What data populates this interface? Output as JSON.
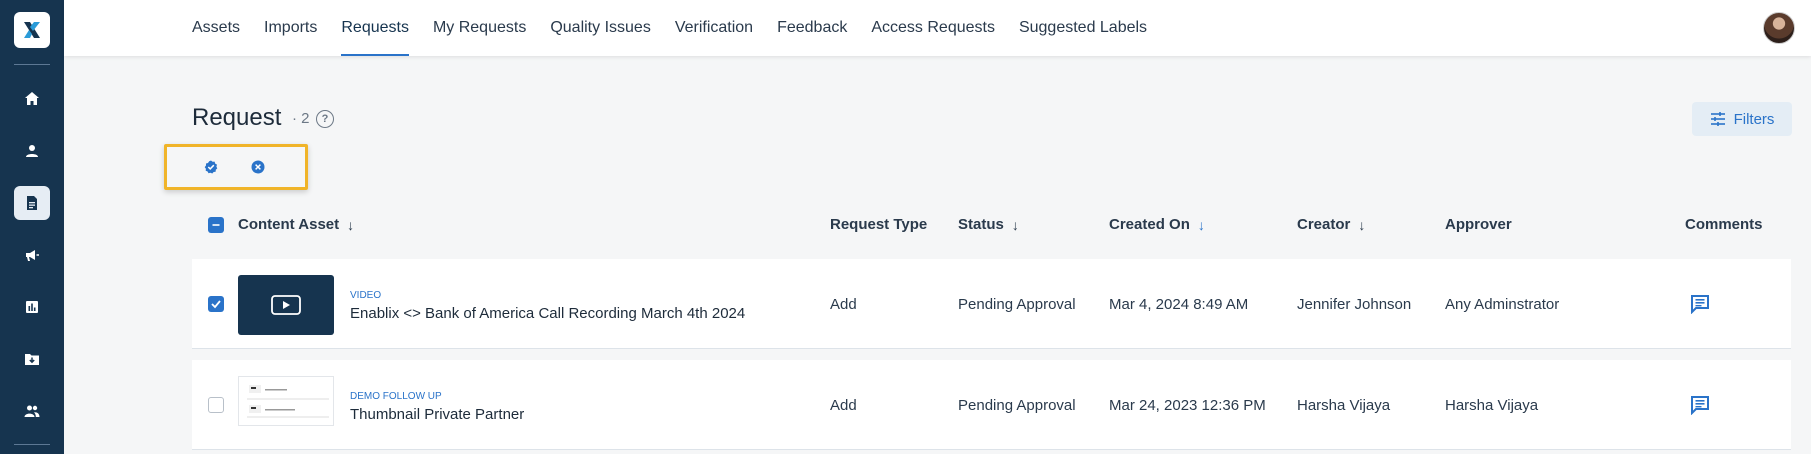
{
  "nav": {
    "tabs": [
      "Assets",
      "Imports",
      "Requests",
      "My Requests",
      "Quality Issues",
      "Verification",
      "Feedback",
      "Access Requests",
      "Suggested Labels"
    ],
    "active_index": 2
  },
  "sidebar": {
    "items": [
      "home-icon",
      "person-icon",
      "document-icon",
      "campaign-icon",
      "analytics-icon",
      "folder-download-icon",
      "people-icon"
    ],
    "active_index": 2
  },
  "page": {
    "title": "Request",
    "count": "· 2",
    "help": "?"
  },
  "filters_label": "Filters",
  "table": {
    "headers": {
      "content_asset": "Content Asset",
      "request_type": "Request Type",
      "status": "Status",
      "created_on": "Created On",
      "creator": "Creator",
      "approver": "Approver",
      "comments": "Comments"
    },
    "rows": [
      {
        "checked": true,
        "thumb": "video",
        "asset_type": "VIDEO",
        "asset_name": "Enablix <> Bank of America Call Recording March 4th 2024",
        "request_type": "Add",
        "status": "Pending Approval",
        "created_on": "Mar 4, 2024 8:49 AM",
        "creator": "Jennifer Johnson",
        "approver": "Any Adminstrator"
      },
      {
        "checked": false,
        "thumb": "document",
        "asset_type": "DEMO FOLLOW UP",
        "asset_name": "Thumbnail Private Partner",
        "request_type": "Add",
        "status": "Pending Approval",
        "created_on": "Mar 24, 2023 12:36 PM",
        "creator": "Harsha Vijaya",
        "approver": "Harsha Vijaya"
      }
    ]
  },
  "colors": {
    "sidebar": "#16344f",
    "accent": "#2a73c9",
    "highlight": "#f0b429"
  }
}
